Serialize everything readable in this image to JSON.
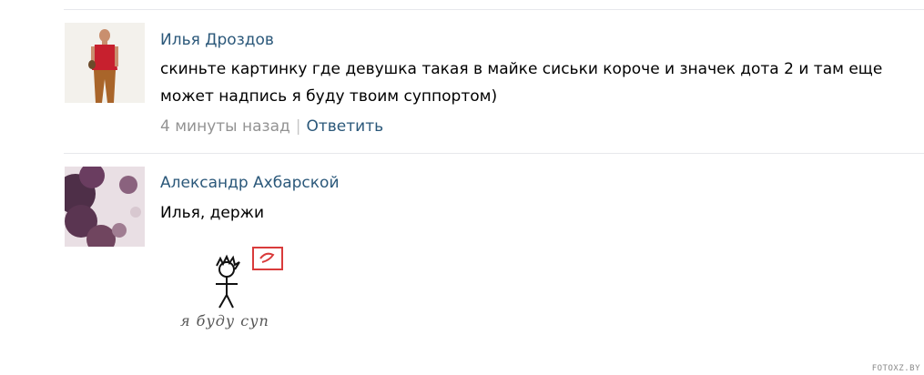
{
  "comments": [
    {
      "author": "Илья Дроздов",
      "text": "скиньте картинку где девушка такая в майке сиськи короче и значек дота 2 и там еще может надпись я буду твоим суппортом)",
      "time": "4 минуты назад",
      "separator": "|",
      "reply_label": "Ответить",
      "avatar_icon": "user-photo-red-shirt"
    },
    {
      "author": "Александр Ахбарской",
      "text": "Илья, держи",
      "avatar_icon": "user-photo-purple-foliage",
      "attachment": {
        "icon": "stick-figure-drawing",
        "caption": "я буду суп"
      }
    }
  ],
  "watermark": "FOTOXZ.BY",
  "colors": {
    "link": "#2b587a",
    "meta": "#939393",
    "separator_line": "#e7e8ec",
    "badge_red": "#d93b3b"
  }
}
